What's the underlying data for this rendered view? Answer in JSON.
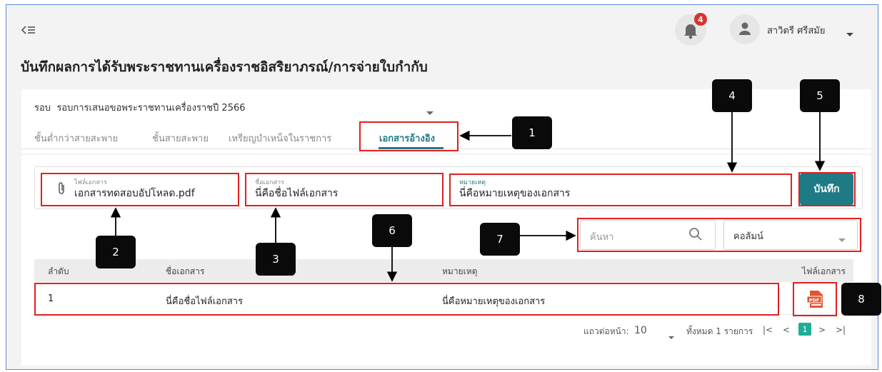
{
  "header": {
    "menu_icon": "menu-collapse-icon",
    "notification_count": "4",
    "user_name": "สาวิตรี ศรีสมัย"
  },
  "page": {
    "title": "บันทึกผลการได้รับพระราชทานเครื่องราชอิสริยาภรณ์/การจ่ายใบกำกับ"
  },
  "round": {
    "label": "รอบ",
    "value": "รอบการเสนอขอพระราชทานเครื่องราชปี 2566"
  },
  "tabs": [
    {
      "label": "ชั้นต่ำกว่าสายสะพาย"
    },
    {
      "label": "ชั้นสายสะพาย"
    },
    {
      "label": "เหรียญบำเหน็จในราชการ"
    },
    {
      "label": "เอกสารอ้างอิง"
    }
  ],
  "form": {
    "file_label": "ไฟล์เอกสาร",
    "file_value": "เอกสารทดสอบอัปโหลด.pdf",
    "name_label": "ชื่อเอกสาร",
    "name_value": "นี่คือชื่อไฟล์เอกสาร",
    "note_label": "หมายเหตุ",
    "note_value": "นี่คือหมายเหตุของเอกสาร",
    "save_label": "บันทึก"
  },
  "search": {
    "placeholder": "ค้นหา",
    "column_label": "คอลัมน์"
  },
  "table": {
    "headers": {
      "no": "ลำดับ",
      "name": "ชื่อเอกสาร",
      "note": "หมายเหตุ",
      "file": "ไฟล์เอกสาร"
    },
    "rows": [
      {
        "no": "1",
        "name": "นี่คือชื่อไฟล์เอกสาร",
        "note": "นี่คือหมายเหตุของเอกสาร",
        "file_icon": "pdf-icon"
      }
    ]
  },
  "pager": {
    "rows_per_page_label": "แถวต่อหน้า:",
    "rows_per_page": "10",
    "total": "ทั้งหมด 1 รายการ",
    "current_page": "1"
  },
  "callouts": [
    "1",
    "2",
    "3",
    "4",
    "5",
    "6",
    "7",
    "8"
  ],
  "colors": {
    "accent": "#1e7a85",
    "highlight": "#e02020",
    "badge": "#d9342b",
    "page_active": "#1eae98"
  }
}
